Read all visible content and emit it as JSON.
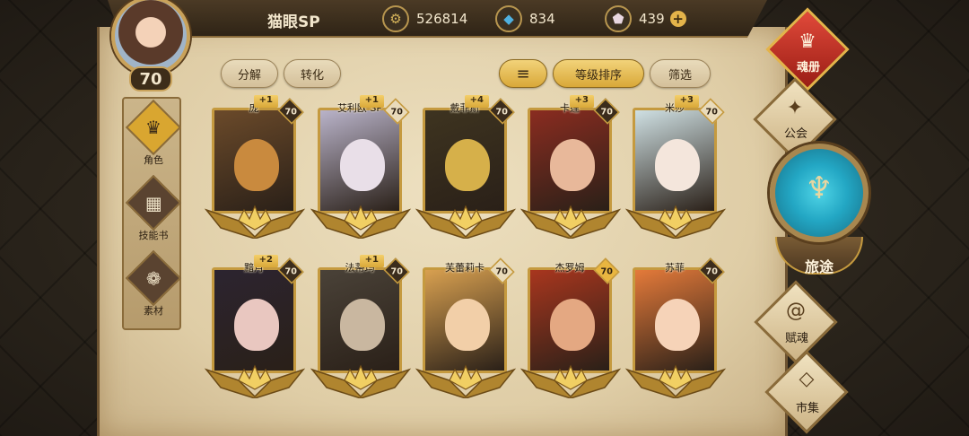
{
  "player": {
    "name": "猫眼SP",
    "level": "70"
  },
  "resources": [
    {
      "name": "coin-icon",
      "icon": "⚙",
      "value": "526814",
      "color": "#d4b25a"
    },
    {
      "name": "crystal-icon",
      "icon": "◆",
      "value": "834",
      "color": "#4fb0e0"
    },
    {
      "name": "gem-icon",
      "icon": "⬟",
      "value": "439",
      "color": "#e8d6e0"
    }
  ],
  "resource_plus": "+",
  "sidebar": [
    {
      "label": "角色",
      "icon": "♛"
    },
    {
      "label": "技能书",
      "icon": "▦"
    },
    {
      "label": "素材",
      "icon": "❁"
    }
  ],
  "actions": {
    "decompose": "分解",
    "convert": "转化",
    "sort_icon": "≡",
    "sort_level": "等级排序",
    "filter": "筛选"
  },
  "heroes": [
    {
      "name": "庞",
      "level": "70",
      "plus": "+1",
      "level_style": "dark",
      "bg": "#6b4a2a",
      "face": "#c98a3e"
    },
    {
      "name": "艾利欧 SP",
      "level": "70",
      "plus": "+1",
      "level_style": "light",
      "bg": "#b9b3c9",
      "face": "#e9dfe8"
    },
    {
      "name": "戴菲斯",
      "level": "70",
      "plus": "+4",
      "level_style": "dark",
      "bg": "#3e3420",
      "face": "#d6b04a"
    },
    {
      "name": "卡莲",
      "level": "70",
      "plus": "+3",
      "level_style": "dark",
      "bg": "#8a2c20",
      "face": "#e8b89a"
    },
    {
      "name": "米莎",
      "level": "70",
      "plus": "+3",
      "level_style": "light",
      "bg": "#cfe0e3",
      "face": "#f4e6dc"
    },
    {
      "name": "黯月",
      "level": "70",
      "plus": "+2",
      "level_style": "dark",
      "bg": "#2c2430",
      "face": "#e9c7c0"
    },
    {
      "name": "法蒂玛",
      "level": "70",
      "plus": "+1",
      "level_style": "dark",
      "bg": "#4a4238",
      "face": "#c9b7a0"
    },
    {
      "name": "芙蕾莉卡",
      "level": "70",
      "plus": "",
      "level_style": "light",
      "bg": "#d8a050",
      "face": "#f2cfa8"
    },
    {
      "name": "杰罗姆",
      "level": "70",
      "plus": "",
      "level_style": "gold",
      "bg": "#a8361e",
      "face": "#e4a882"
    },
    {
      "name": "苏菲",
      "level": "70",
      "plus": "",
      "level_style": "dark",
      "bg": "#e47a3a",
      "face": "#f6d3b8"
    }
  ],
  "nav": {
    "soul_book": "魂册",
    "guild": "公会",
    "journey": "旅途",
    "soul_gift": "赋魂",
    "market": "市集"
  }
}
